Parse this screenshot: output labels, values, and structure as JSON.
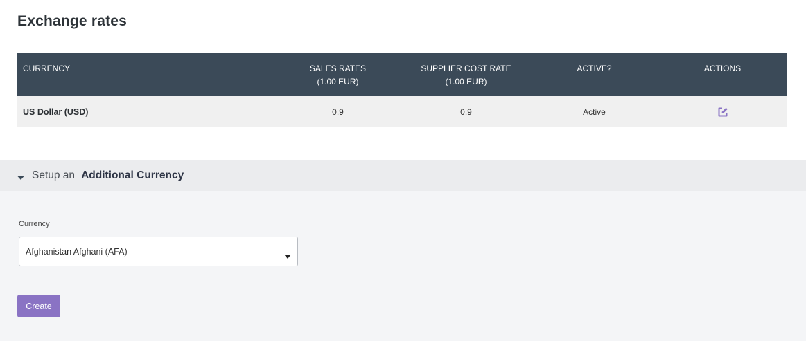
{
  "page": {
    "title": "Exchange rates"
  },
  "table": {
    "headers": {
      "currency": "CURRENCY",
      "sales_rates": "SALES RATES",
      "sales_rates_sub": "(1.00 EUR)",
      "supplier_cost_rate": "SUPPLIER COST RATE",
      "supplier_cost_rate_sub": "(1.00 EUR)",
      "active": "ACTIVE?",
      "actions": "ACTIONS"
    },
    "rows": [
      {
        "currency": "US Dollar (USD)",
        "sales_rate": "0.9",
        "supplier_cost_rate": "0.9",
        "active": "Active",
        "action_icon": "edit-icon"
      }
    ]
  },
  "setup": {
    "prefix": "Setup an",
    "title": "Additional Currency",
    "toggle_icon": "caret-down-icon",
    "currency_label": "Currency",
    "currency_value": "Afghanistan Afghani (AFA)",
    "create_label": "Create"
  },
  "colors": {
    "header_bg": "#3b4a58",
    "row_bg": "#f0f0f0",
    "accent": "#8a73c4"
  }
}
